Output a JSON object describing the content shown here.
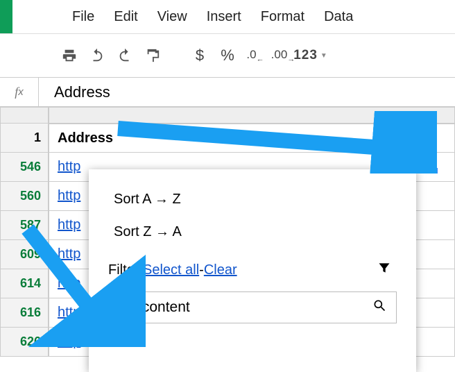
{
  "menu": {
    "file": "File",
    "edit": "Edit",
    "view": "View",
    "insert": "Insert",
    "format": "Format",
    "data": "Data"
  },
  "toolbar": {
    "currency": "$",
    "percent": "%",
    "dec_less": ".0",
    "dec_more": ".00",
    "numfmt": "123"
  },
  "formula": {
    "fx": "fx",
    "value": "Address"
  },
  "rows": {
    "headers": [
      "1",
      "546",
      "560",
      "587",
      "609",
      "614",
      "616",
      "626"
    ],
    "A_header": "Address",
    "A_cells": [
      "http",
      "http",
      "http",
      "http",
      "http",
      "http",
      "http"
    ]
  },
  "dropdown": {
    "sort_az": "Sort A → Z",
    "sort_za": "Sort Z → A",
    "filter_label": "Filter: ",
    "select_all": "Select all",
    "sep": " - ",
    "clear": "Clear",
    "search_value": "wp-content"
  }
}
